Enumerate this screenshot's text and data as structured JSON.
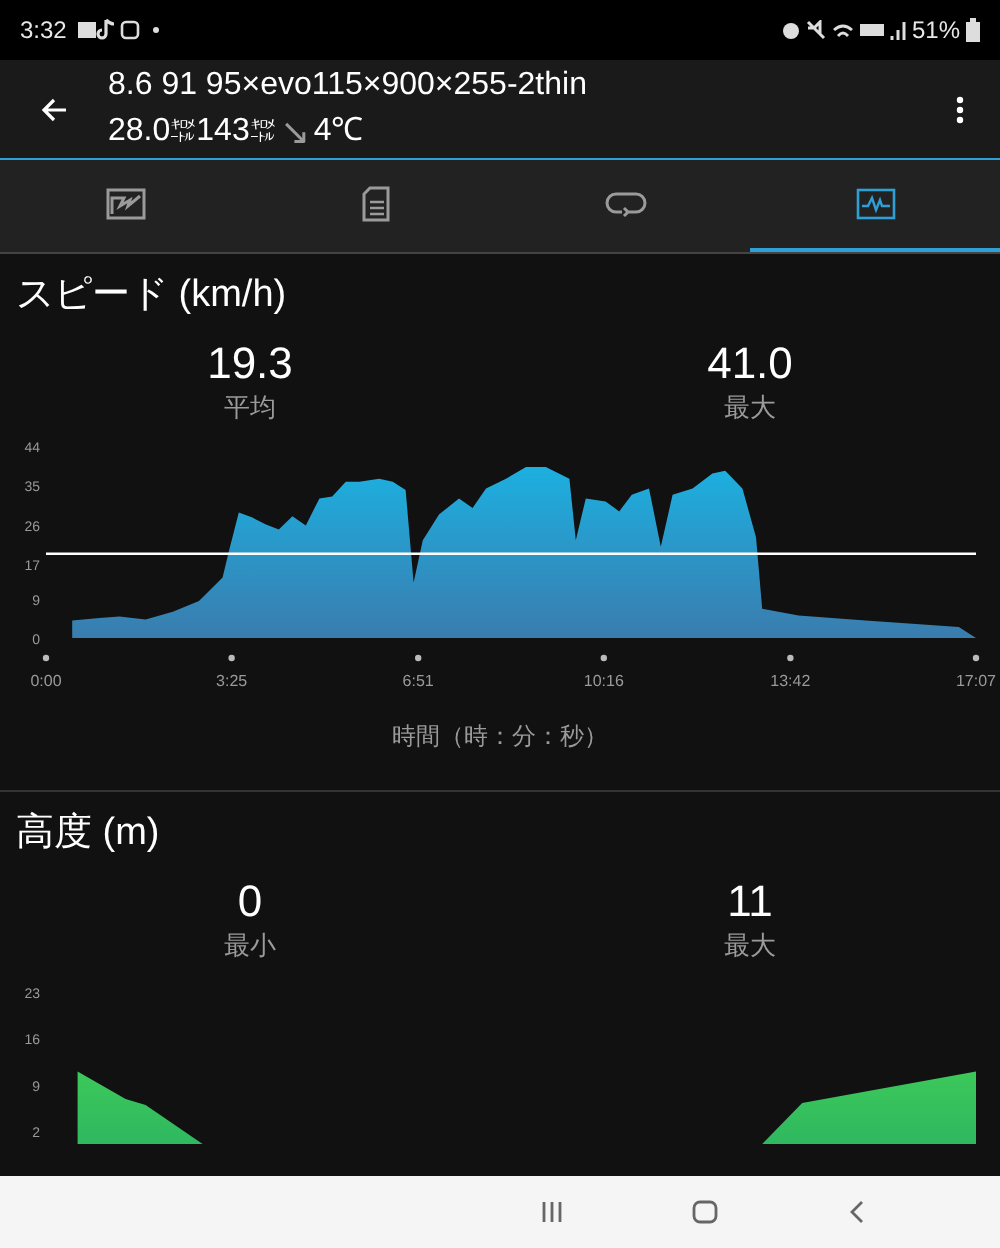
{
  "status_bar": {
    "time": "3:32",
    "battery": "51%"
  },
  "header": {
    "title": "8.6 91 95×evo115×900×255-2thin",
    "distance": "28.0",
    "distance_unit": "㌖",
    "ascent": "143",
    "ascent_unit": "㌖",
    "trend": "↘",
    "temperature": "4℃"
  },
  "tabs": [
    {
      "kind": "map",
      "selected": false
    },
    {
      "kind": "document",
      "selected": false
    },
    {
      "kind": "laps",
      "selected": false
    },
    {
      "kind": "chart",
      "selected": true
    }
  ],
  "sections": [
    {
      "title": "スピード (km/h)",
      "stats": [
        {
          "value": "19.3",
          "label": "平均"
        },
        {
          "value": "41.0",
          "label": "最大"
        }
      ],
      "chart_data": {
        "type": "area",
        "xlabel": "時間（時：分：秒）",
        "xlim": [
          0,
          1027
        ],
        "ylim": [
          0,
          44
        ],
        "x": [
          29,
          59,
          81,
          110,
          140,
          169,
          195,
          202,
          213,
          228,
          243,
          257,
          272,
          287,
          302,
          316,
          331,
          346,
          368,
          383,
          397,
          406,
          416,
          434,
          456,
          471,
          486,
          508,
          530,
          552,
          578,
          585,
          596,
          618,
          633,
          647,
          666,
          679,
          692,
          714,
          736,
          750,
          769,
          784,
          791,
          831,
          905,
          1008,
          1027
        ],
        "series": [
          {
            "color": "#1cb0e0",
            "values": [
              4,
              4.6,
              4.9,
              4.2,
              6,
              8.5,
              13.9,
              20,
              28.8,
              27.6,
              26,
              24.9,
              27.9,
              25.8,
              32,
              32.4,
              35.8,
              35.8,
              36.5,
              35.8,
              33.9,
              12.7,
              22.4,
              28.3,
              32,
              29.8,
              34.3,
              36.5,
              39.2,
              39.2,
              36.5,
              22.4,
              32,
              31.3,
              29,
              32.8,
              34.3,
              20.9,
              32.8,
              34.3,
              37.7,
              38.3,
              34.3,
              23.1,
              6.7,
              5.2,
              4,
              2.5,
              0
            ]
          }
        ],
        "xticks": [
          {
            "value": 0,
            "label": "0:00"
          },
          {
            "value": 205,
            "label": "3:25"
          },
          {
            "value": 411,
            "label": "6:51"
          },
          {
            "value": 616,
            "label": "10:16"
          },
          {
            "value": 822,
            "label": "13:42"
          },
          {
            "value": 1027,
            "label": "17:07"
          }
        ],
        "yticks": [
          0,
          9,
          17,
          26,
          35,
          44
        ],
        "ref_lines": [
          {
            "axis": "y",
            "value": 19.3
          }
        ]
      }
    },
    {
      "title": "高度 (m)",
      "stats": [
        {
          "value": "0",
          "label": "最小"
        },
        {
          "value": "11",
          "label": "最大"
        }
      ],
      "chart_data": {
        "type": "area",
        "xlim": [
          0,
          1027
        ],
        "ylim": [
          0,
          23
        ],
        "x": [
          35,
          88,
          110,
          173,
          791,
          835,
          1027
        ],
        "series": [
          {
            "color": "#3cc85a",
            "values": [
              11,
              6.8,
              5.9,
              0,
              0,
              6.2,
              11
            ]
          }
        ],
        "yticks": [
          2,
          9,
          16,
          23
        ]
      }
    }
  ]
}
